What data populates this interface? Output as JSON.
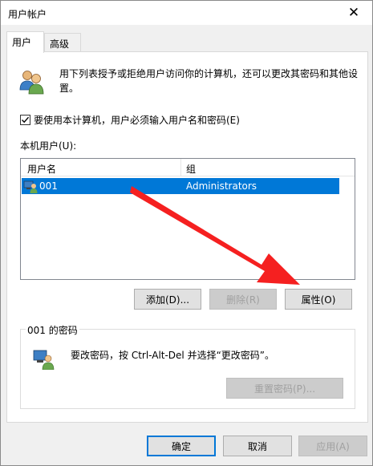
{
  "window": {
    "title": "用户帐户"
  },
  "tabs": [
    {
      "label": "用户"
    },
    {
      "label": "高级"
    }
  ],
  "intro": {
    "text": "用下列表授予或拒绝用户访问你的计算机，还可以更改其密码和其他设置。"
  },
  "require_login": {
    "label": "要使用本计算机，用户必须输入用户名和密码(E)",
    "checked": true
  },
  "users_list": {
    "label": "本机用户(U):",
    "columns": [
      "用户名",
      "组"
    ],
    "rows": [
      {
        "username": "001",
        "group": "Administrators"
      }
    ]
  },
  "list_buttons": {
    "add": "添加(D)...",
    "remove": "删除(R)",
    "properties": "属性(O)"
  },
  "password_group": {
    "title": "001 的密码",
    "text": "要改密码，按 Ctrl-Alt-Del 并选择“更改密码”。",
    "reset": "重置密码(P)..."
  },
  "footer": {
    "ok": "确定",
    "cancel": "取消",
    "apply": "应用(A)"
  },
  "colors": {
    "selection": "#0078d7",
    "annotation_arrow": "#f52020"
  }
}
